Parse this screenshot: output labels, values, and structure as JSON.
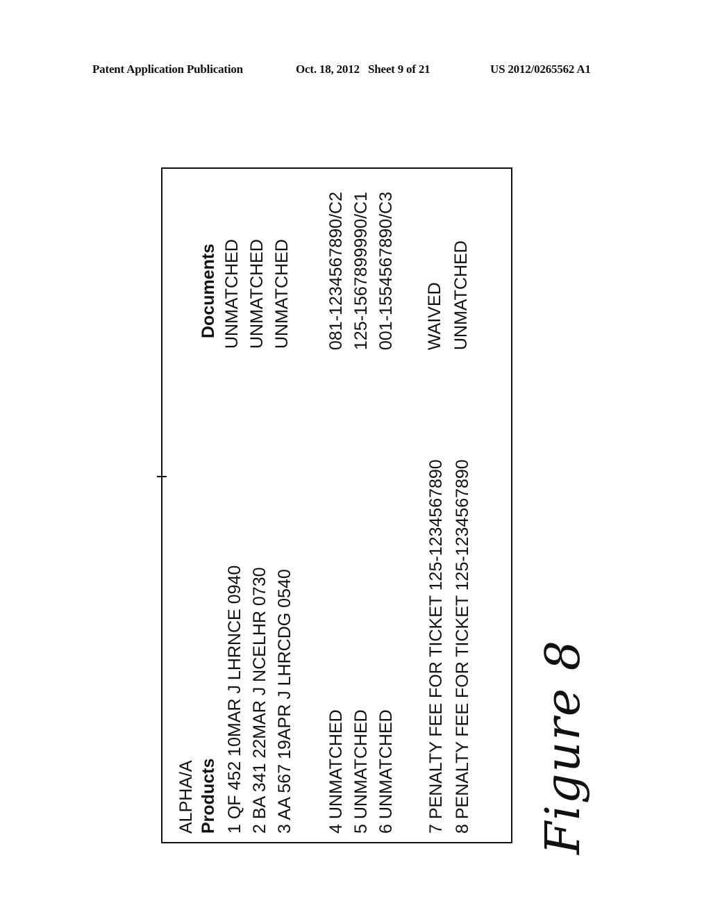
{
  "header": {
    "left": "Patent Application Publication",
    "middle": "Oct. 18, 2012   Sheet 9 of 21",
    "right": "US 2012/0265562 A1"
  },
  "figure": {
    "title_line": "ALPHA/A",
    "products_header": "Products",
    "documents_header": "Documents",
    "rows": [
      {
        "product": "1 QF 452 10MAR J LHRNCE 0940",
        "document": "UNMATCHED"
      },
      {
        "product": "2 BA 341 22MAR J NCELHR 0730",
        "document": "UNMATCHED"
      },
      {
        "product": "3 AA 567 19APR J  LHRCDG 0540",
        "document": "UNMATCHED"
      },
      {
        "product": "4 UNMATCHED",
        "document": "081-1234567890/C2"
      },
      {
        "product": "5 UNMATCHED",
        "document": "125-1567899990/C1"
      },
      {
        "product": "6 UNMATCHED",
        "document": "001-1554567890/C3"
      },
      {
        "product": "7 PENALTY FEE FOR TICKET 125-1234567890",
        "document": "WAIVED"
      },
      {
        "product": "8 PENALTY FEE FOR TICKET 125-1234567890",
        "document": "UNMATCHED"
      }
    ],
    "caption": "Figure 8"
  }
}
